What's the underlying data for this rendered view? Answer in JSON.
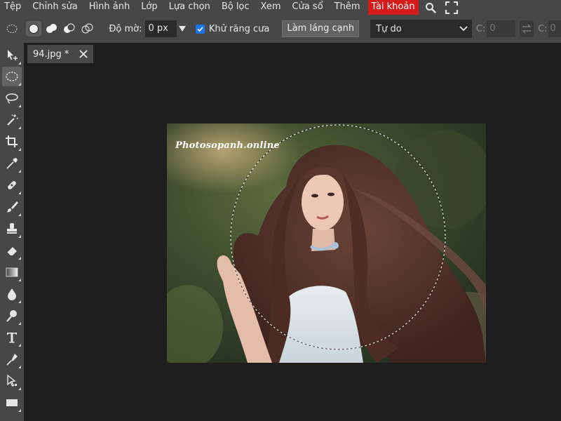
{
  "menu": {
    "items": [
      "Tệp",
      "Chỉnh sửa",
      "Hình ảnh",
      "Lớp",
      "Lựa chọn",
      "Bộ lọc",
      "Xem",
      "Cửa sổ",
      "Thêm"
    ],
    "account": "Tài khoản",
    "account_color": "#d71b1b",
    "icons": [
      "search-icon",
      "fullscreen-icon"
    ]
  },
  "options": {
    "feather_label": "Độ mờ:",
    "feather_value": "0 px",
    "antialias_label": "Khử răng cưa",
    "antialias_checked": true,
    "refine_edge": "Làm láng cạnh",
    "style_value": "Tự do",
    "width_label": "C:",
    "width_value": "0",
    "height_label": "C:",
    "height_value": "0"
  },
  "toolbar": {
    "active_tool": "elliptical-marquee-tool",
    "tools": [
      "move-tool",
      "elliptical-marquee-tool",
      "lasso-tool",
      "magic-wand-tool",
      "crop-tool",
      "eyedropper-tool",
      "healing-brush-tool",
      "brush-tool",
      "clone-stamp-tool",
      "eraser-tool",
      "gradient-tool",
      "blur-tool",
      "dodge-tool",
      "type-tool",
      "pen-tool",
      "path-selection-tool",
      "rectangle-tool"
    ]
  },
  "document": {
    "tab_title": "94.jpg *",
    "watermark": "Photosopanh.online"
  },
  "accent_color": "#1a73e8"
}
